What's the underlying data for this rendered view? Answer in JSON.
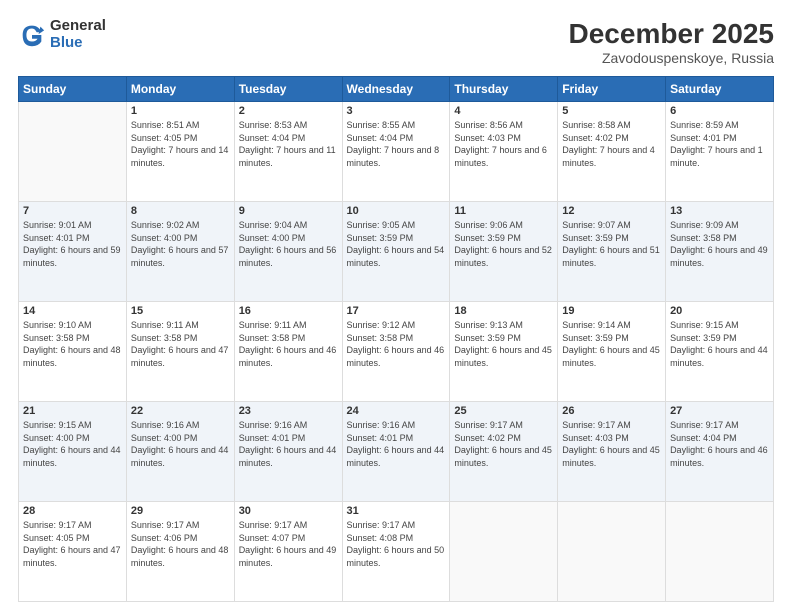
{
  "logo": {
    "general": "General",
    "blue": "Blue"
  },
  "title": "December 2025",
  "subtitle": "Zavodouspenskoye, Russia",
  "headers": [
    "Sunday",
    "Monday",
    "Tuesday",
    "Wednesday",
    "Thursday",
    "Friday",
    "Saturday"
  ],
  "weeks": [
    [
      {
        "day": "",
        "sunrise": "",
        "sunset": "",
        "daylight": ""
      },
      {
        "day": "1",
        "sunrise": "Sunrise: 8:51 AM",
        "sunset": "Sunset: 4:05 PM",
        "daylight": "Daylight: 7 hours and 14 minutes."
      },
      {
        "day": "2",
        "sunrise": "Sunrise: 8:53 AM",
        "sunset": "Sunset: 4:04 PM",
        "daylight": "Daylight: 7 hours and 11 minutes."
      },
      {
        "day": "3",
        "sunrise": "Sunrise: 8:55 AM",
        "sunset": "Sunset: 4:04 PM",
        "daylight": "Daylight: 7 hours and 8 minutes."
      },
      {
        "day": "4",
        "sunrise": "Sunrise: 8:56 AM",
        "sunset": "Sunset: 4:03 PM",
        "daylight": "Daylight: 7 hours and 6 minutes."
      },
      {
        "day": "5",
        "sunrise": "Sunrise: 8:58 AM",
        "sunset": "Sunset: 4:02 PM",
        "daylight": "Daylight: 7 hours and 4 minutes."
      },
      {
        "day": "6",
        "sunrise": "Sunrise: 8:59 AM",
        "sunset": "Sunset: 4:01 PM",
        "daylight": "Daylight: 7 hours and 1 minute."
      }
    ],
    [
      {
        "day": "7",
        "sunrise": "Sunrise: 9:01 AM",
        "sunset": "Sunset: 4:01 PM",
        "daylight": "Daylight: 6 hours and 59 minutes."
      },
      {
        "day": "8",
        "sunrise": "Sunrise: 9:02 AM",
        "sunset": "Sunset: 4:00 PM",
        "daylight": "Daylight: 6 hours and 57 minutes."
      },
      {
        "day": "9",
        "sunrise": "Sunrise: 9:04 AM",
        "sunset": "Sunset: 4:00 PM",
        "daylight": "Daylight: 6 hours and 56 minutes."
      },
      {
        "day": "10",
        "sunrise": "Sunrise: 9:05 AM",
        "sunset": "Sunset: 3:59 PM",
        "daylight": "Daylight: 6 hours and 54 minutes."
      },
      {
        "day": "11",
        "sunrise": "Sunrise: 9:06 AM",
        "sunset": "Sunset: 3:59 PM",
        "daylight": "Daylight: 6 hours and 52 minutes."
      },
      {
        "day": "12",
        "sunrise": "Sunrise: 9:07 AM",
        "sunset": "Sunset: 3:59 PM",
        "daylight": "Daylight: 6 hours and 51 minutes."
      },
      {
        "day": "13",
        "sunrise": "Sunrise: 9:09 AM",
        "sunset": "Sunset: 3:58 PM",
        "daylight": "Daylight: 6 hours and 49 minutes."
      }
    ],
    [
      {
        "day": "14",
        "sunrise": "Sunrise: 9:10 AM",
        "sunset": "Sunset: 3:58 PM",
        "daylight": "Daylight: 6 hours and 48 minutes."
      },
      {
        "day": "15",
        "sunrise": "Sunrise: 9:11 AM",
        "sunset": "Sunset: 3:58 PM",
        "daylight": "Daylight: 6 hours and 47 minutes."
      },
      {
        "day": "16",
        "sunrise": "Sunrise: 9:11 AM",
        "sunset": "Sunset: 3:58 PM",
        "daylight": "Daylight: 6 hours and 46 minutes."
      },
      {
        "day": "17",
        "sunrise": "Sunrise: 9:12 AM",
        "sunset": "Sunset: 3:58 PM",
        "daylight": "Daylight: 6 hours and 46 minutes."
      },
      {
        "day": "18",
        "sunrise": "Sunrise: 9:13 AM",
        "sunset": "Sunset: 3:59 PM",
        "daylight": "Daylight: 6 hours and 45 minutes."
      },
      {
        "day": "19",
        "sunrise": "Sunrise: 9:14 AM",
        "sunset": "Sunset: 3:59 PM",
        "daylight": "Daylight: 6 hours and 45 minutes."
      },
      {
        "day": "20",
        "sunrise": "Sunrise: 9:15 AM",
        "sunset": "Sunset: 3:59 PM",
        "daylight": "Daylight: 6 hours and 44 minutes."
      }
    ],
    [
      {
        "day": "21",
        "sunrise": "Sunrise: 9:15 AM",
        "sunset": "Sunset: 4:00 PM",
        "daylight": "Daylight: 6 hours and 44 minutes."
      },
      {
        "day": "22",
        "sunrise": "Sunrise: 9:16 AM",
        "sunset": "Sunset: 4:00 PM",
        "daylight": "Daylight: 6 hours and 44 minutes."
      },
      {
        "day": "23",
        "sunrise": "Sunrise: 9:16 AM",
        "sunset": "Sunset: 4:01 PM",
        "daylight": "Daylight: 6 hours and 44 minutes."
      },
      {
        "day": "24",
        "sunrise": "Sunrise: 9:16 AM",
        "sunset": "Sunset: 4:01 PM",
        "daylight": "Daylight: 6 hours and 44 minutes."
      },
      {
        "day": "25",
        "sunrise": "Sunrise: 9:17 AM",
        "sunset": "Sunset: 4:02 PM",
        "daylight": "Daylight: 6 hours and 45 minutes."
      },
      {
        "day": "26",
        "sunrise": "Sunrise: 9:17 AM",
        "sunset": "Sunset: 4:03 PM",
        "daylight": "Daylight: 6 hours and 45 minutes."
      },
      {
        "day": "27",
        "sunrise": "Sunrise: 9:17 AM",
        "sunset": "Sunset: 4:04 PM",
        "daylight": "Daylight: 6 hours and 46 minutes."
      }
    ],
    [
      {
        "day": "28",
        "sunrise": "Sunrise: 9:17 AM",
        "sunset": "Sunset: 4:05 PM",
        "daylight": "Daylight: 6 hours and 47 minutes."
      },
      {
        "day": "29",
        "sunrise": "Sunrise: 9:17 AM",
        "sunset": "Sunset: 4:06 PM",
        "daylight": "Daylight: 6 hours and 48 minutes."
      },
      {
        "day": "30",
        "sunrise": "Sunrise: 9:17 AM",
        "sunset": "Sunset: 4:07 PM",
        "daylight": "Daylight: 6 hours and 49 minutes."
      },
      {
        "day": "31",
        "sunrise": "Sunrise: 9:17 AM",
        "sunset": "Sunset: 4:08 PM",
        "daylight": "Daylight: 6 hours and 50 minutes."
      },
      {
        "day": "",
        "sunrise": "",
        "sunset": "",
        "daylight": ""
      },
      {
        "day": "",
        "sunrise": "",
        "sunset": "",
        "daylight": ""
      },
      {
        "day": "",
        "sunrise": "",
        "sunset": "",
        "daylight": ""
      }
    ]
  ]
}
